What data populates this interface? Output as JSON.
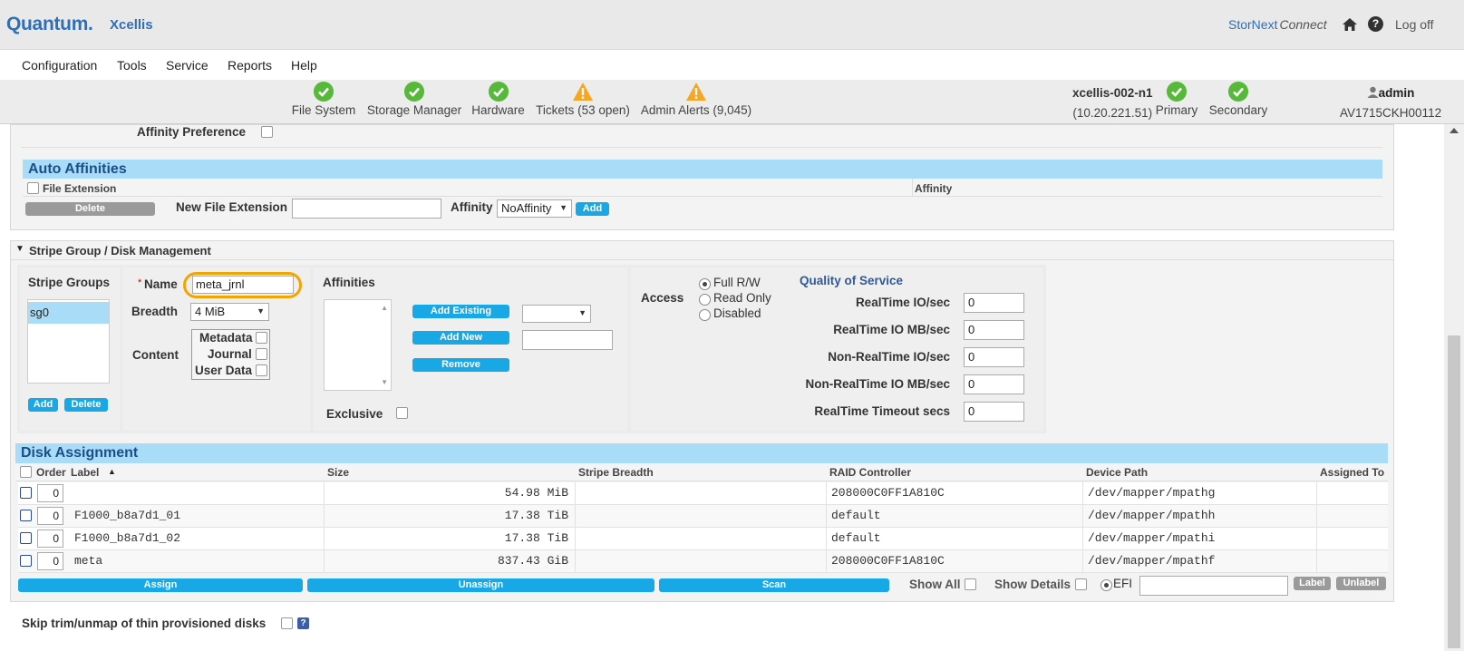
{
  "header": {
    "brand": "Quantum.",
    "product": "Xcellis",
    "connect_brand": "StorNext",
    "connect_suffix": "Connect",
    "logoff": "Log off"
  },
  "menu": [
    "Configuration",
    "Tools",
    "Service",
    "Reports",
    "Help"
  ],
  "status": {
    "items": [
      {
        "label": "File System",
        "state": "ok"
      },
      {
        "label": "Storage Manager",
        "state": "ok"
      },
      {
        "label": "Hardware",
        "state": "ok"
      },
      {
        "label": "Tickets (53 open)",
        "state": "warning"
      },
      {
        "label": "Admin Alerts (9,045)",
        "state": "warning"
      }
    ],
    "host_name": "xcellis-002-n1",
    "host_ip": "(10.20.221.51)",
    "primary": "Primary",
    "secondary": "Secondary",
    "user": "admin",
    "serial": "AV1715CKH00112"
  },
  "affinity_pref": {
    "label": "Affinity Preference"
  },
  "auto_affinities": {
    "title": "Auto Affinities",
    "col_file_ext": "File Extension",
    "col_affinity": "Affinity",
    "delete": "Delete",
    "new_ext_label": "New File Extension",
    "affinity_label": "Affinity",
    "affinity_value": "NoAffinity",
    "add": "Add"
  },
  "stripe_section": {
    "title": "Stripe Group / Disk Management",
    "stripe_groups_label": "Stripe Groups",
    "groups": [
      "sg0"
    ],
    "add": "Add",
    "delete": "Delete",
    "name_label": "Name",
    "name_value": "meta_jrnl",
    "breadth_label": "Breadth",
    "breadth_value": "4 MiB",
    "content_label": "Content",
    "content_options": [
      "Metadata",
      "Journal",
      "User Data"
    ],
    "affinities_label": "Affinities",
    "add_existing": "Add Existing",
    "add_new": "Add New",
    "remove": "Remove",
    "exclusive_label": "Exclusive",
    "access_label": "Access",
    "access_options": [
      "Full R/W",
      "Read Only",
      "Disabled"
    ],
    "qos_title": "Quality of Service",
    "qos_fields": [
      {
        "label": "RealTime IO/sec",
        "value": "0"
      },
      {
        "label": "RealTime IO MB/sec",
        "value": "0"
      },
      {
        "label": "Non-RealTime IO/sec",
        "value": "0"
      },
      {
        "label": "Non-RealTime IO MB/sec",
        "value": "0"
      },
      {
        "label": "RealTime Timeout secs",
        "value": "0"
      }
    ]
  },
  "disk_assignment": {
    "title": "Disk Assignment",
    "columns": [
      "Order",
      "Label",
      "Size",
      "Stripe Breadth",
      "RAID Controller",
      "Device Path",
      "Assigned To"
    ],
    "rows": [
      {
        "order": "0",
        "label": "",
        "size": "54.98 MiB",
        "stripe_breadth": "",
        "raid": "208000C0FF1A810C",
        "path": "/dev/mapper/mpathg",
        "assigned": ""
      },
      {
        "order": "0",
        "label": "F1000_b8a7d1_01",
        "size": "17.38 TiB",
        "stripe_breadth": "",
        "raid": "default",
        "path": "/dev/mapper/mpathh",
        "assigned": ""
      },
      {
        "order": "0",
        "label": "F1000_b8a7d1_02",
        "size": "17.38 TiB",
        "stripe_breadth": "",
        "raid": "default",
        "path": "/dev/mapper/mpathi",
        "assigned": ""
      },
      {
        "order": "0",
        "label": "meta",
        "size": "837.43 GiB",
        "stripe_breadth": "",
        "raid": "208000C0FF1A810C",
        "path": "/dev/mapper/mpathf",
        "assigned": ""
      }
    ],
    "assign": "Assign",
    "unassign": "Unassign",
    "scan": "Scan",
    "show_all": "Show All",
    "show_details": "Show Details",
    "efi": "EFI",
    "label_btn": "Label",
    "unlabel_btn": "Unlabel"
  },
  "skip_trim": {
    "label": "Skip trim/unmap of thin provisioned disks"
  }
}
